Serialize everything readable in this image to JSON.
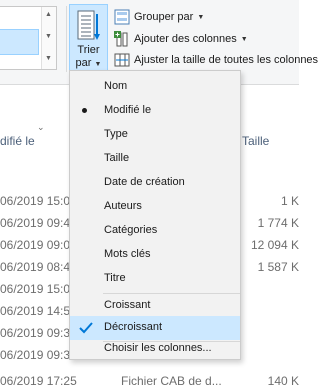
{
  "ribbon": {
    "sort_button": {
      "line1": "Trier",
      "line2": "par"
    },
    "group_by": "Grouper par",
    "add_columns": "Ajouter des colonnes",
    "fit_columns": "Ajuster la taille de toutes les colonnes"
  },
  "columns": {
    "modified": "difié le",
    "size": "Taille"
  },
  "rows": [
    {
      "date": "06/2019 15:0",
      "size": "1 K"
    },
    {
      "date": "06/2019 09:4",
      "size": "1 774 K"
    },
    {
      "date": "06/2019 09:0",
      "size": "12 094 K"
    },
    {
      "date": "06/2019 08:4",
      "size": "1 587 K"
    },
    {
      "date": "06/2019 15:0",
      "size": ""
    },
    {
      "date": "06/2019 14:5",
      "size": ""
    },
    {
      "date": "06/2019 09:3",
      "size": ""
    },
    {
      "date": "06/2019 09:3",
      "size": ""
    },
    {
      "date": "06/2019 17:25",
      "type": "Fichier CAB de d...",
      "size": "140 K"
    }
  ],
  "sort_menu": {
    "fields": [
      "Nom",
      "Modifié le",
      "Type",
      "Taille",
      "Date de création",
      "Auteurs",
      "Catégories",
      "Mots clés",
      "Titre"
    ],
    "order": [
      "Croissant",
      "Décroissant"
    ],
    "choose_columns": "Choisir les colonnes..."
  },
  "colors": {
    "accent": "#0078d7",
    "selection": "#cce8ff"
  }
}
